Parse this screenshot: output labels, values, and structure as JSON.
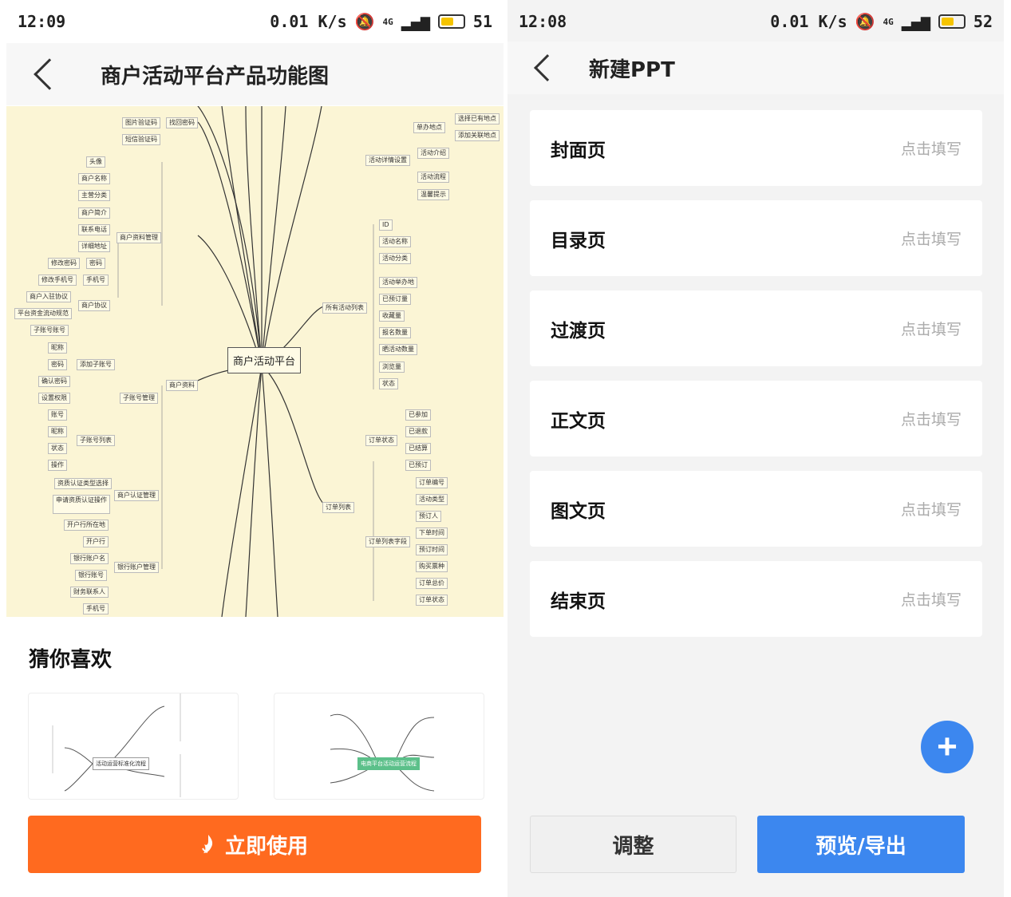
{
  "left": {
    "status": {
      "time": "12:09",
      "speed": "0.01 K/s",
      "network": "4G",
      "battery": "51"
    },
    "title": "商户活动平台产品功能图",
    "mindmap": {
      "center": "商户活动平台",
      "nodes": [
        "图片验证码",
        "短信验证码",
        "找回密码",
        "头像",
        "商户名称",
        "主营分类",
        "商户简介",
        "联系电话",
        "详细地址",
        "修改密码",
        "密码",
        "修改手机号",
        "手机号",
        "商户入驻协议",
        "平台资金流动规范",
        "商户协议",
        "商户资料管理",
        "子账号账号",
        "昵称",
        "密码",
        "确认密码",
        "设置权限",
        "添加子账号",
        "账号",
        "昵称",
        "状态",
        "操作",
        "子账号列表",
        "子账号管理",
        "商户资料",
        "资质认证类型选择",
        "申请资质认证操作",
        "商户认证管理",
        "开户行所在地",
        "开户行",
        "银行账户名",
        "银行账号",
        "财务联系人",
        "手机号",
        "银行账户管理",
        "单办地点",
        "选择已有地点",
        "添加关联地点",
        "活动介绍",
        "活动流程",
        "温馨提示",
        "活动详情设置",
        "ID",
        "活动名称",
        "活动分类",
        "活动举办地",
        "已预订量",
        "收藏量",
        "报名数量",
        "晒活动数量",
        "浏览量",
        "状态",
        "所有活动列表",
        "已参加",
        "已退款",
        "已结算",
        "已预订",
        "订单状态",
        "订单编号",
        "活动类型",
        "预订人",
        "下单时间",
        "预订时间",
        "购买票种",
        "订单总价",
        "订单状态",
        "订单列表字段",
        "订单列表"
      ]
    },
    "recommend_title": "猜你喜欢",
    "thumb1_label": "活动运营标准化流程",
    "thumb2_label": "电商平台活动运营流程",
    "cta_label": "立即使用"
  },
  "right": {
    "status": {
      "time": "12:08",
      "speed": "0.01 K/s",
      "network": "4G",
      "battery": "52"
    },
    "title": "新建PPT",
    "items": [
      {
        "name": "封面页",
        "hint": "点击填写"
      },
      {
        "name": "目录页",
        "hint": "点击填写"
      },
      {
        "name": "过渡页",
        "hint": "点击填写"
      },
      {
        "name": "正文页",
        "hint": "点击填写"
      },
      {
        "name": "图文页",
        "hint": "点击填写"
      },
      {
        "name": "结束页",
        "hint": "点击填写"
      }
    ],
    "fab_symbol": "+",
    "adjust_label": "调整",
    "export_label": "预览/导出"
  }
}
